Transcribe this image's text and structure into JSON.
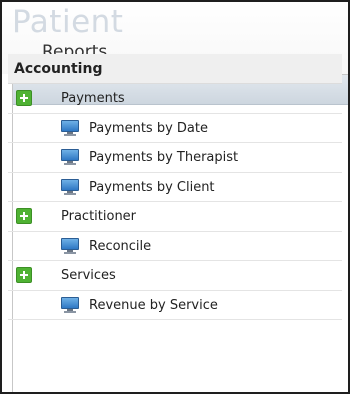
{
  "header": {
    "brand": "Patient",
    "subtitle": "Reports"
  },
  "section": {
    "title": "Accounting"
  },
  "groups": [
    {
      "label": "Payments",
      "items": [
        "Payments by Date",
        "Payments by Therapist",
        "Payments by Client"
      ]
    },
    {
      "label": "Practitioner",
      "items": [
        "Reconcile"
      ]
    },
    {
      "label": "Services",
      "items": [
        "Revenue by Service"
      ]
    }
  ],
  "icons": {
    "expand": "plus-icon",
    "report": "monitor-icon"
  },
  "colors": {
    "brand": "#d3dae2",
    "expand_green": "#4fb233",
    "monitor_blue": "#2f78c4"
  }
}
